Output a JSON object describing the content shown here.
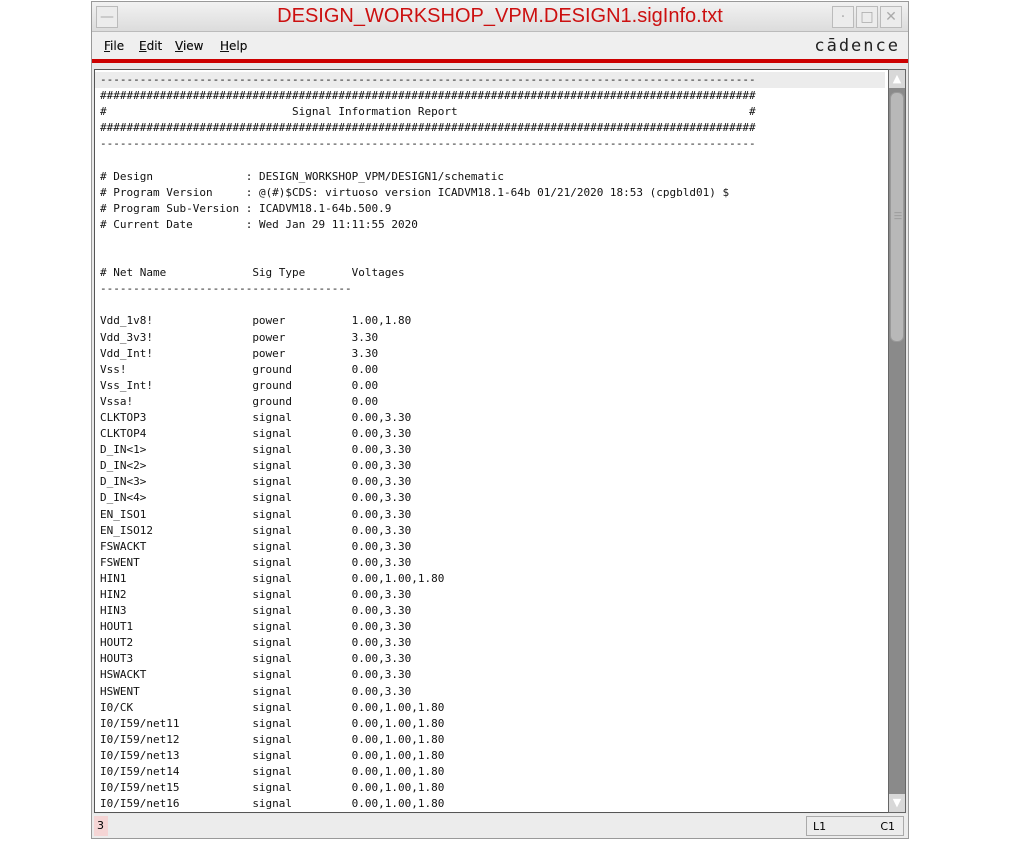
{
  "window": {
    "title": "DESIGN_WORKSHOP_VPM.DESIGN1.sigInfo.txt",
    "minimize_icon": "minimize-icon",
    "maximize_icon": "maximize-icon",
    "close_icon": "close-icon"
  },
  "menu": {
    "items": [
      {
        "label": "File",
        "mn": "F",
        "rest": "ile"
      },
      {
        "label": "Edit",
        "mn": "E",
        "rest": "dit"
      },
      {
        "label": "View",
        "mn": "V",
        "rest": "iew"
      },
      {
        "label": "Help",
        "mn": "H",
        "rest": "elp"
      }
    ],
    "logo": "cādence"
  },
  "report": {
    "dash_line": "---------------------------------------------------------------------------------------------------",
    "hash_line": "###################################################################################################",
    "title_line": "#                            Signal Information Report                                            #",
    "meta": [
      "# Design              : DESIGN_WORKSHOP_VPM/DESIGN1/schematic",
      "# Program Version     : @(#)$CDS: virtuoso version ICADVM18.1-64b 01/21/2020 18:53 (cpgbld01) $",
      "# Program Sub-Version : ICADVM18.1-64b.500.9",
      "# Current Date        : Wed Jan 29 11:11:55 2020"
    ],
    "columns": [
      "# Net Name",
      "Sig Type",
      "Voltages"
    ],
    "col_dash": "--------------------------------------",
    "rows": [
      [
        "Vdd_1v8!",
        "power",
        "1.00,1.80"
      ],
      [
        "Vdd_3v3!",
        "power",
        "3.30"
      ],
      [
        "Vdd_Int!",
        "power",
        "3.30"
      ],
      [
        "Vss!",
        "ground",
        "0.00"
      ],
      [
        "Vss_Int!",
        "ground",
        "0.00"
      ],
      [
        "Vssa!",
        "ground",
        "0.00"
      ],
      [
        "CLKTOP3",
        "signal",
        "0.00,3.30"
      ],
      [
        "CLKTOP4",
        "signal",
        "0.00,3.30"
      ],
      [
        "D_IN<1>",
        "signal",
        "0.00,3.30"
      ],
      [
        "D_IN<2>",
        "signal",
        "0.00,3.30"
      ],
      [
        "D_IN<3>",
        "signal",
        "0.00,3.30"
      ],
      [
        "D_IN<4>",
        "signal",
        "0.00,3.30"
      ],
      [
        "EN_ISO1",
        "signal",
        "0.00,3.30"
      ],
      [
        "EN_ISO12",
        "signal",
        "0.00,3.30"
      ],
      [
        "FSWACKT",
        "signal",
        "0.00,3.30"
      ],
      [
        "FSWENT",
        "signal",
        "0.00,3.30"
      ],
      [
        "HIN1",
        "signal",
        "0.00,1.00,1.80"
      ],
      [
        "HIN2",
        "signal",
        "0.00,3.30"
      ],
      [
        "HIN3",
        "signal",
        "0.00,3.30"
      ],
      [
        "HOUT1",
        "signal",
        "0.00,3.30"
      ],
      [
        "HOUT2",
        "signal",
        "0.00,3.30"
      ],
      [
        "HOUT3",
        "signal",
        "0.00,3.30"
      ],
      [
        "HSWACKT",
        "signal",
        "0.00,3.30"
      ],
      [
        "HSWENT",
        "signal",
        "0.00,3.30"
      ],
      [
        "I0/CK",
        "signal",
        "0.00,1.00,1.80"
      ],
      [
        "I0/I59/net11",
        "signal",
        "0.00,1.00,1.80"
      ],
      [
        "I0/I59/net12",
        "signal",
        "0.00,1.00,1.80"
      ],
      [
        "I0/I59/net13",
        "signal",
        "0.00,1.00,1.80"
      ],
      [
        "I0/I59/net14",
        "signal",
        "0.00,1.00,1.80"
      ],
      [
        "I0/I59/net15",
        "signal",
        "0.00,1.00,1.80"
      ],
      [
        "I0/I59/net16",
        "signal",
        "0.00,1.00,1.80"
      ]
    ]
  },
  "status": {
    "left": "3",
    "line": "L1",
    "col": "C1"
  }
}
